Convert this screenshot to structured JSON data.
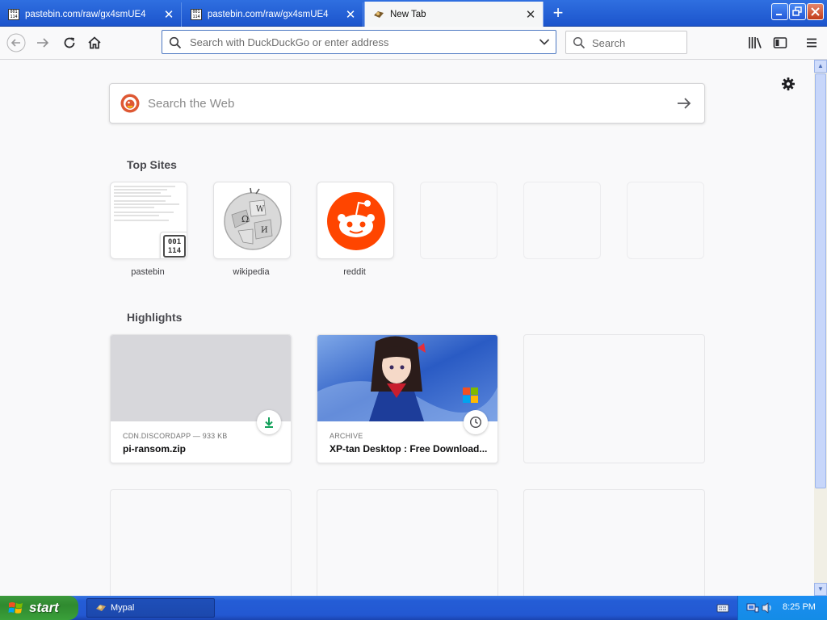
{
  "tabs": [
    {
      "label": "pastebin.com/raw/gx4smUE4",
      "active": false
    },
    {
      "label": "pastebin.com/raw/gx4smUE4",
      "active": false
    },
    {
      "label": "New Tab",
      "active": true
    }
  ],
  "new_tab_icon": "plus-icon",
  "window_controls": [
    "minimize-icon",
    "restore-icon",
    "close-icon"
  ],
  "nav": {
    "back_icon": "back-arrow-icon",
    "forward_icon": "forward-arrow-icon",
    "reload_icon": "reload-icon",
    "home_icon": "home-icon",
    "url_placeholder": "Search with DuckDuckGo or enter address",
    "search_placeholder": "Search",
    "library_icon": "library-icon",
    "sidebar_icon": "sidebar-icon",
    "menu_icon": "hamburger-menu-icon"
  },
  "newtab": {
    "websearch_placeholder": "Search the Web",
    "top_sites_title": "Top Sites",
    "highlights_title": "Highlights",
    "top_sites": [
      {
        "label": "pastebin",
        "icon": "pastebin-icon"
      },
      {
        "label": "wikipedia",
        "icon": "wikipedia-globe-icon"
      },
      {
        "label": "reddit",
        "icon": "reddit-alien-icon"
      },
      {
        "label": ""
      },
      {
        "label": ""
      },
      {
        "label": ""
      }
    ],
    "highlights": [
      {
        "meta": "CDN.DISCORDAPP — 933 KB",
        "title": "pi-ransom.zip",
        "badge": "download-icon"
      },
      {
        "meta": "ARCHIVE",
        "title": "XP-tan Desktop : Free Download...",
        "badge": "clock-icon"
      }
    ]
  },
  "taskbar": {
    "start_label": "start",
    "task_label": "Mypal",
    "clock": "8:25 PM"
  },
  "colors": {
    "tabbar_blue": "#1f5ad0",
    "page_background": "#f9f9fa",
    "reddit_orange": "#ff4500",
    "download_green": "#12a05a",
    "start_green": "#3a9a3a",
    "taskbar_blue": "#245dd6"
  }
}
